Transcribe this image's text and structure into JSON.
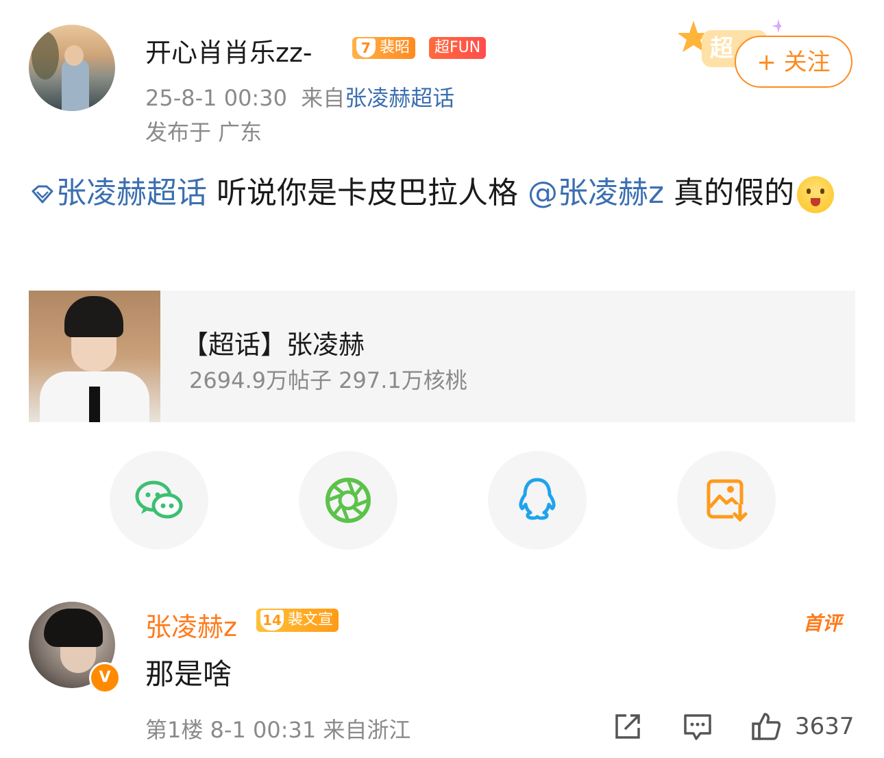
{
  "post": {
    "author": "开心肖肖乐zz-",
    "level": "7",
    "level_badge_text": "裴昭",
    "fun_badge": "超FUN",
    "time": "25-8-1 00:30",
    "source_prefix": "来自",
    "source_link": "张凌赫超话",
    "location": "发布于 广东",
    "follow_label": "+ 关注",
    "follow_deco_text": "超",
    "text_topic": "张凌赫超话",
    "text_mid": " 听说你是卡皮巴拉人格 ",
    "text_mention": "@张凌赫z",
    "text_end": " 真的假的",
    "emoji_name": "hug-emoji"
  },
  "topic_card": {
    "title": "【超话】张凌赫",
    "stats": "2694.9万帖子 297.1万核桃"
  },
  "share": [
    {
      "name": "wechat-icon",
      "color": "#3dbf72"
    },
    {
      "name": "moments-icon",
      "color": "#5cc24a"
    },
    {
      "name": "qq-icon",
      "color": "#1fa3ec"
    },
    {
      "name": "save-image-icon",
      "color": "#ff9a1a"
    }
  ],
  "comment": {
    "author": "张凌赫z",
    "level": "14",
    "level_badge_text": "裴文宣",
    "verified": "V",
    "first_tag": "首评",
    "text": "那是啥",
    "meta": "第1楼 8-1 00:31 来自浙江",
    "like_count": "3637"
  },
  "colors": {
    "accent": "#ff8a1f",
    "link": "#3b6fb0",
    "meta": "#8a8a8a",
    "card_bg": "#f5f5f5"
  }
}
